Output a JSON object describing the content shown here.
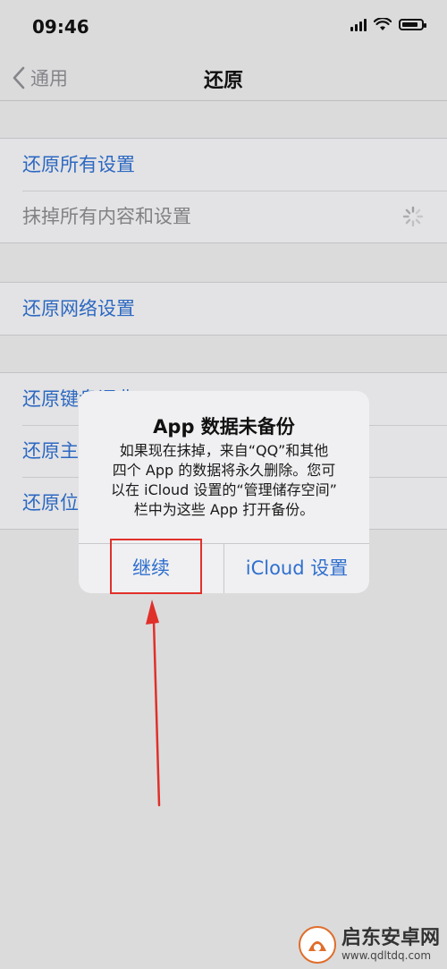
{
  "status_bar": {
    "time": "09:46"
  },
  "nav": {
    "back_label": "通用",
    "title": "还原"
  },
  "groups": [
    {
      "items": [
        {
          "label": "还原所有设置"
        },
        {
          "label": "抹掉所有内容和设置"
        }
      ]
    },
    {
      "items": [
        {
          "label": "还原网络设置"
        }
      ]
    },
    {
      "items": [
        {
          "label": "还原键盘词典"
        },
        {
          "label": "还原主屏幕布局"
        },
        {
          "label": "还原位置与隐私"
        }
      ]
    }
  ],
  "alert": {
    "title": "App 数据未备份",
    "message_lines": [
      "如果现在抹掉，来自“QQ”和其他",
      "四个 App 的数据将永久删除。您可",
      "以在 iCloud 设置的“管理储存空间”",
      "栏中为这些 App 打开备份。"
    ],
    "continue_label": "继续",
    "icloud_label": "iCloud 设置"
  },
  "watermark": {
    "name": "启东安卓网",
    "url": "www.qdltdq.com"
  },
  "colors": {
    "link": "#2f6fce",
    "annotation": "#e0302a",
    "background": "#e9e9ea"
  }
}
